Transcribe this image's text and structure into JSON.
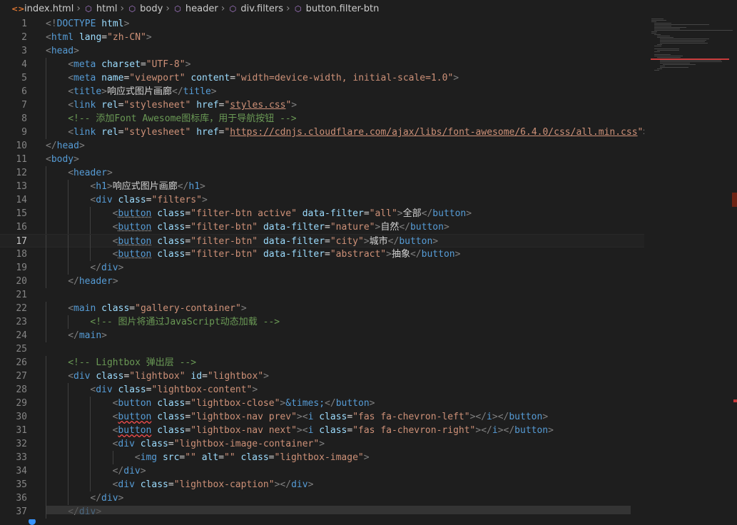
{
  "breadcrumb": [
    "index.html",
    "html",
    "body",
    "header",
    "div.filters",
    "button.filter-btn"
  ],
  "current_line": 17,
  "lines": [
    {
      "n": 1,
      "indent": 0,
      "tokens": [
        [
          "br",
          "<!"
        ],
        [
          "tag",
          "DOCTYPE"
        ],
        [
          "txt",
          " "
        ],
        [
          "attr",
          "html"
        ],
        [
          "br",
          ">"
        ]
      ]
    },
    {
      "n": 2,
      "indent": 0,
      "tokens": [
        [
          "br",
          "<"
        ],
        [
          "tag",
          "html"
        ],
        [
          "txt",
          " "
        ],
        [
          "attr",
          "lang"
        ],
        [
          "txt",
          "="
        ],
        [
          "str",
          "\"zh-CN\""
        ],
        [
          "br",
          ">"
        ]
      ]
    },
    {
      "n": 3,
      "indent": 0,
      "tokens": [
        [
          "br",
          "<"
        ],
        [
          "tag",
          "head"
        ],
        [
          "br",
          ">"
        ]
      ]
    },
    {
      "n": 4,
      "indent": 1,
      "tokens": [
        [
          "br",
          "<"
        ],
        [
          "tag",
          "meta"
        ],
        [
          "txt",
          " "
        ],
        [
          "attr",
          "charset"
        ],
        [
          "txt",
          "="
        ],
        [
          "str",
          "\"UTF-8\""
        ],
        [
          "br",
          ">"
        ]
      ]
    },
    {
      "n": 5,
      "indent": 1,
      "tokens": [
        [
          "br",
          "<"
        ],
        [
          "tag",
          "meta"
        ],
        [
          "txt",
          " "
        ],
        [
          "attr",
          "name"
        ],
        [
          "txt",
          "="
        ],
        [
          "str",
          "\"viewport\""
        ],
        [
          "txt",
          " "
        ],
        [
          "attr",
          "content"
        ],
        [
          "txt",
          "="
        ],
        [
          "str",
          "\"width=device-width, initial-scale=1.0\""
        ],
        [
          "br",
          ">"
        ]
      ]
    },
    {
      "n": 6,
      "indent": 1,
      "tokens": [
        [
          "br",
          "<"
        ],
        [
          "tag",
          "title"
        ],
        [
          "br",
          ">"
        ],
        [
          "txt",
          "响应式图片画廊"
        ],
        [
          "br",
          "</"
        ],
        [
          "tag",
          "title"
        ],
        [
          "br",
          ">"
        ]
      ]
    },
    {
      "n": 7,
      "indent": 1,
      "tokens": [
        [
          "br",
          "<"
        ],
        [
          "tag",
          "link"
        ],
        [
          "txt",
          " "
        ],
        [
          "attr",
          "rel"
        ],
        [
          "txt",
          "="
        ],
        [
          "str",
          "\"stylesheet\""
        ],
        [
          "txt",
          " "
        ],
        [
          "attr",
          "href"
        ],
        [
          "txt",
          "="
        ],
        [
          "str",
          "\""
        ],
        [
          "url",
          "styles.css"
        ],
        [
          "str",
          "\""
        ],
        [
          "br",
          ">"
        ]
      ]
    },
    {
      "n": 8,
      "indent": 1,
      "tokens": [
        [
          "com",
          "<!-- 添加Font Awesome图标库，用于导航按钮 -->"
        ]
      ]
    },
    {
      "n": 9,
      "indent": 1,
      "tokens": [
        [
          "br",
          "<"
        ],
        [
          "tag",
          "link"
        ],
        [
          "txt",
          " "
        ],
        [
          "attr",
          "rel"
        ],
        [
          "txt",
          "="
        ],
        [
          "str",
          "\"stylesheet\""
        ],
        [
          "txt",
          " "
        ],
        [
          "attr",
          "href"
        ],
        [
          "txt",
          "="
        ],
        [
          "str",
          "\""
        ],
        [
          "url",
          "https://cdnjs.cloudflare.com/ajax/libs/font-awesome/6.4.0/css/all.min.css"
        ],
        [
          "str",
          "\""
        ],
        [
          "br",
          ">"
        ]
      ]
    },
    {
      "n": 10,
      "indent": 0,
      "tokens": [
        [
          "br",
          "</"
        ],
        [
          "tag",
          "head"
        ],
        [
          "br",
          ">"
        ]
      ]
    },
    {
      "n": 11,
      "indent": 0,
      "tokens": [
        [
          "br",
          "<"
        ],
        [
          "tag",
          "body"
        ],
        [
          "br",
          ">"
        ]
      ]
    },
    {
      "n": 12,
      "indent": 1,
      "tokens": [
        [
          "br",
          "<"
        ],
        [
          "tag",
          "header"
        ],
        [
          "br",
          ">"
        ]
      ]
    },
    {
      "n": 13,
      "indent": 2,
      "tokens": [
        [
          "br",
          "<"
        ],
        [
          "tag",
          "h1"
        ],
        [
          "br",
          ">"
        ],
        [
          "txt",
          "响应式图片画廊"
        ],
        [
          "br",
          "</"
        ],
        [
          "tag",
          "h1"
        ],
        [
          "br",
          ">"
        ]
      ]
    },
    {
      "n": 14,
      "indent": 2,
      "tokens": [
        [
          "br",
          "<"
        ],
        [
          "tag",
          "div"
        ],
        [
          "txt",
          " "
        ],
        [
          "attr",
          "class"
        ],
        [
          "txt",
          "="
        ],
        [
          "str",
          "\"filters\""
        ],
        [
          "br",
          ">"
        ]
      ]
    },
    {
      "n": 15,
      "indent": 3,
      "tokens": [
        [
          "br",
          "<"
        ],
        [
          "tag",
          "button"
        ],
        [
          "txt",
          " "
        ],
        [
          "attr",
          "class"
        ],
        [
          "txt",
          "="
        ],
        [
          "str",
          "\"filter-btn active\""
        ],
        [
          "txt",
          " "
        ],
        [
          "attr",
          "data-filter"
        ],
        [
          "txt",
          "="
        ],
        [
          "str",
          "\"all\""
        ],
        [
          "br",
          ">"
        ],
        [
          "txt",
          "全部"
        ],
        [
          "br",
          "</"
        ],
        [
          "tag",
          "button"
        ],
        [
          "br",
          ">"
        ]
      ]
    },
    {
      "n": 16,
      "indent": 3,
      "tokens": [
        [
          "br",
          "<"
        ],
        [
          "tag",
          "button"
        ],
        [
          "txt",
          " "
        ],
        [
          "attr",
          "class"
        ],
        [
          "txt",
          "="
        ],
        [
          "str",
          "\"filter-btn\""
        ],
        [
          "txt",
          " "
        ],
        [
          "attr",
          "data-filter"
        ],
        [
          "txt",
          "="
        ],
        [
          "str",
          "\"nature\""
        ],
        [
          "br",
          ">"
        ],
        [
          "txt",
          "自然"
        ],
        [
          "br",
          "</"
        ],
        [
          "tag",
          "button"
        ],
        [
          "br",
          ">"
        ]
      ]
    },
    {
      "n": 17,
      "indent": 3,
      "tokens": [
        [
          "br",
          "<"
        ],
        [
          "tag",
          "button"
        ],
        [
          "txt",
          " "
        ],
        [
          "attr",
          "class"
        ],
        [
          "txt",
          "="
        ],
        [
          "str",
          "\"filter-btn\""
        ],
        [
          "txt",
          " "
        ],
        [
          "attr",
          "data-filter"
        ],
        [
          "txt",
          "="
        ],
        [
          "str",
          "\"city\""
        ],
        [
          "br",
          ">"
        ],
        [
          "txt",
          "城市"
        ],
        [
          "br",
          "</"
        ],
        [
          "tag",
          "button"
        ],
        [
          "br",
          ">"
        ]
      ]
    },
    {
      "n": 18,
      "indent": 3,
      "tokens": [
        [
          "br",
          "<"
        ],
        [
          "tag",
          "button"
        ],
        [
          "txt",
          " "
        ],
        [
          "attr",
          "class"
        ],
        [
          "txt",
          "="
        ],
        [
          "str",
          "\"filter-btn\""
        ],
        [
          "txt",
          " "
        ],
        [
          "attr",
          "data-filter"
        ],
        [
          "txt",
          "="
        ],
        [
          "str",
          "\"abstract\""
        ],
        [
          "br",
          ">"
        ],
        [
          "txt",
          "抽象"
        ],
        [
          "br",
          "</"
        ],
        [
          "tag",
          "button"
        ],
        [
          "br",
          ">"
        ]
      ]
    },
    {
      "n": 19,
      "indent": 2,
      "tokens": [
        [
          "br",
          "</"
        ],
        [
          "tag",
          "div"
        ],
        [
          "br",
          ">"
        ]
      ]
    },
    {
      "n": 20,
      "indent": 1,
      "tokens": [
        [
          "br",
          "</"
        ],
        [
          "tag",
          "header"
        ],
        [
          "br",
          ">"
        ]
      ]
    },
    {
      "n": 21,
      "indent": 0,
      "tokens": []
    },
    {
      "n": 22,
      "indent": 1,
      "tokens": [
        [
          "br",
          "<"
        ],
        [
          "tag",
          "main"
        ],
        [
          "txt",
          " "
        ],
        [
          "attr",
          "class"
        ],
        [
          "txt",
          "="
        ],
        [
          "str",
          "\"gallery-container\""
        ],
        [
          "br",
          ">"
        ]
      ]
    },
    {
      "n": 23,
      "indent": 2,
      "tokens": [
        [
          "com",
          "<!-- 图片将通过JavaScript动态加载 -->"
        ]
      ]
    },
    {
      "n": 24,
      "indent": 1,
      "tokens": [
        [
          "br",
          "</"
        ],
        [
          "tag",
          "main"
        ],
        [
          "br",
          ">"
        ]
      ]
    },
    {
      "n": 25,
      "indent": 0,
      "tokens": []
    },
    {
      "n": 26,
      "indent": 1,
      "tokens": [
        [
          "com",
          "<!-- Lightbox 弹出层 -->"
        ]
      ]
    },
    {
      "n": 27,
      "indent": 1,
      "tokens": [
        [
          "br",
          "<"
        ],
        [
          "tag",
          "div"
        ],
        [
          "txt",
          " "
        ],
        [
          "attr",
          "class"
        ],
        [
          "txt",
          "="
        ],
        [
          "str",
          "\"lightbox\""
        ],
        [
          "txt",
          " "
        ],
        [
          "attr",
          "id"
        ],
        [
          "txt",
          "="
        ],
        [
          "str",
          "\"lightbox\""
        ],
        [
          "br",
          ">"
        ]
      ]
    },
    {
      "n": 28,
      "indent": 2,
      "tokens": [
        [
          "br",
          "<"
        ],
        [
          "tag",
          "div"
        ],
        [
          "txt",
          " "
        ],
        [
          "attr",
          "class"
        ],
        [
          "txt",
          "="
        ],
        [
          "str",
          "\"lightbox-content\""
        ],
        [
          "br",
          ">"
        ]
      ]
    },
    {
      "n": 29,
      "indent": 3,
      "tokens": [
        [
          "br",
          "<"
        ],
        [
          "tag",
          "button"
        ],
        [
          "txt",
          " "
        ],
        [
          "attr",
          "class"
        ],
        [
          "txt",
          "="
        ],
        [
          "str",
          "\"lightbox-close\""
        ],
        [
          "br",
          ">"
        ],
        [
          "ent",
          "&times;"
        ],
        [
          "br",
          "</"
        ],
        [
          "tag",
          "button"
        ],
        [
          "br",
          ">"
        ]
      ]
    },
    {
      "n": 30,
      "indent": 3,
      "tokens": [
        [
          "br",
          "<"
        ],
        [
          "tagsq",
          "button"
        ],
        [
          "txt",
          " "
        ],
        [
          "attr",
          "class"
        ],
        [
          "txt",
          "="
        ],
        [
          "str",
          "\"lightbox-nav prev\""
        ],
        [
          "br",
          ">"
        ],
        [
          "br",
          "<"
        ],
        [
          "tag",
          "i"
        ],
        [
          "txt",
          " "
        ],
        [
          "attr",
          "class"
        ],
        [
          "txt",
          "="
        ],
        [
          "str",
          "\"fas fa-chevron-left\""
        ],
        [
          "br",
          "></"
        ],
        [
          "tag",
          "i"
        ],
        [
          "br",
          "></"
        ],
        [
          "tag",
          "button"
        ],
        [
          "br",
          ">"
        ]
      ]
    },
    {
      "n": 31,
      "indent": 3,
      "tokens": [
        [
          "br",
          "<"
        ],
        [
          "tagsq",
          "button"
        ],
        [
          "txt",
          " "
        ],
        [
          "attr",
          "class"
        ],
        [
          "txt",
          "="
        ],
        [
          "str",
          "\"lightbox-nav next\""
        ],
        [
          "br",
          ">"
        ],
        [
          "br",
          "<"
        ],
        [
          "tag",
          "i"
        ],
        [
          "txt",
          " "
        ],
        [
          "attr",
          "class"
        ],
        [
          "txt",
          "="
        ],
        [
          "str",
          "\"fas fa-chevron-right\""
        ],
        [
          "br",
          "></"
        ],
        [
          "tag",
          "i"
        ],
        [
          "br",
          "></"
        ],
        [
          "tag",
          "button"
        ],
        [
          "br",
          ">"
        ]
      ]
    },
    {
      "n": 32,
      "indent": 3,
      "tokens": [
        [
          "br",
          "<"
        ],
        [
          "tag",
          "div"
        ],
        [
          "txt",
          " "
        ],
        [
          "attr",
          "class"
        ],
        [
          "txt",
          "="
        ],
        [
          "str",
          "\"lightbox-image-container\""
        ],
        [
          "br",
          ">"
        ]
      ]
    },
    {
      "n": 33,
      "indent": 4,
      "tokens": [
        [
          "br",
          "<"
        ],
        [
          "tag",
          "img"
        ],
        [
          "txt",
          " "
        ],
        [
          "attr",
          "src"
        ],
        [
          "txt",
          "="
        ],
        [
          "str",
          "\"\""
        ],
        [
          "txt",
          " "
        ],
        [
          "attr",
          "alt"
        ],
        [
          "txt",
          "="
        ],
        [
          "str",
          "\"\""
        ],
        [
          "txt",
          " "
        ],
        [
          "attr",
          "class"
        ],
        [
          "txt",
          "="
        ],
        [
          "str",
          "\"lightbox-image\""
        ],
        [
          "br",
          ">"
        ]
      ]
    },
    {
      "n": 34,
      "indent": 3,
      "tokens": [
        [
          "br",
          "</"
        ],
        [
          "tag",
          "div"
        ],
        [
          "br",
          ">"
        ]
      ]
    },
    {
      "n": 35,
      "indent": 3,
      "tokens": [
        [
          "br",
          "<"
        ],
        [
          "tag",
          "div"
        ],
        [
          "txt",
          " "
        ],
        [
          "attr",
          "class"
        ],
        [
          "txt",
          "="
        ],
        [
          "str",
          "\"lightbox-caption\""
        ],
        [
          "br",
          "></"
        ],
        [
          "tag",
          "div"
        ],
        [
          "br",
          ">"
        ]
      ]
    },
    {
      "n": 36,
      "indent": 2,
      "tokens": [
        [
          "br",
          "</"
        ],
        [
          "tag",
          "div"
        ],
        [
          "br",
          ">"
        ]
      ]
    },
    {
      "n": 37,
      "indent": 1,
      "tokens": [
        [
          "br",
          "</"
        ],
        [
          "tag",
          "div"
        ],
        [
          "br",
          ">"
        ]
      ]
    }
  ]
}
